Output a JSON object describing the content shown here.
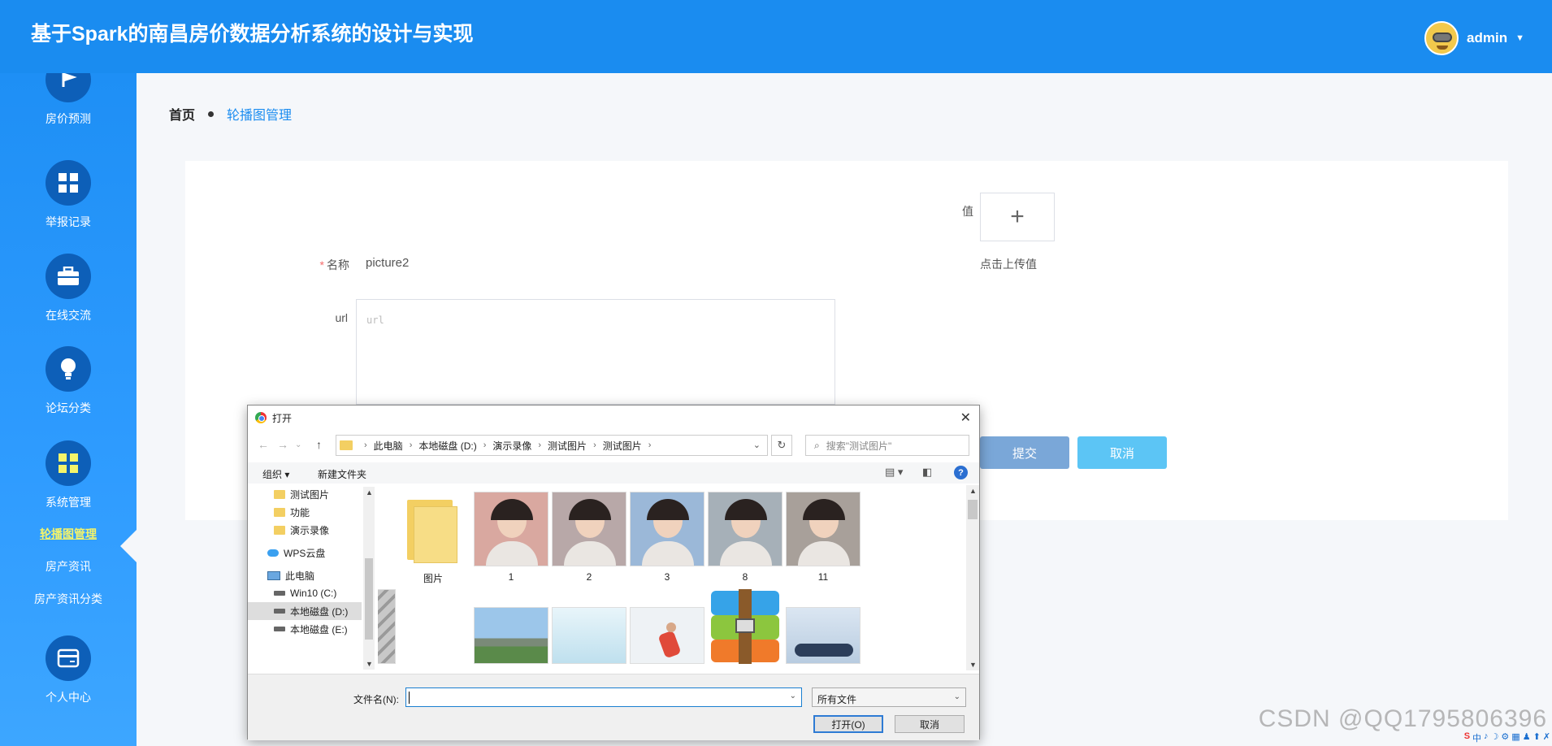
{
  "header": {
    "title": "基于Spark的南昌房价数据分析系统的设计与实现",
    "username": "admin"
  },
  "sidebar": {
    "items": [
      {
        "label": "房价预测",
        "icon": "flag-icon"
      },
      {
        "label": "举报记录",
        "icon": "grid-icon"
      },
      {
        "label": "在线交流",
        "icon": "briefcase-icon"
      },
      {
        "label": "论坛分类",
        "icon": "bulb-icon"
      },
      {
        "label": "系统管理",
        "icon": "grid-icon"
      },
      {
        "label": "个人中心",
        "icon": "card-icon"
      }
    ],
    "sub_items": [
      {
        "label": "轮播图管理",
        "active": true
      },
      {
        "label": "房产资讯",
        "active": false
      },
      {
        "label": "房产资讯分类",
        "active": false
      }
    ]
  },
  "breadcrumb": {
    "home": "首页",
    "current": "轮播图管理"
  },
  "form": {
    "name_label": "名称",
    "name_required": "*",
    "name_value": "picture2",
    "url_label": "url",
    "url_placeholder": "url",
    "value_label": "值",
    "upload_icon": "+",
    "upload_hint": "点击上传值",
    "submit_label": "提交",
    "cancel_label": "取消"
  },
  "dialog": {
    "title": "打开",
    "close": "✕",
    "path": [
      "此电脑",
      "本地磁盘 (D:)",
      "演示录像",
      "测试图片",
      "测试图片"
    ],
    "search_placeholder": "搜索\"测试图片\"",
    "toolbar": {
      "organize": "组织 ▾",
      "new_folder": "新建文件夹"
    },
    "tree": [
      {
        "label": "测试图片",
        "icon": "folder"
      },
      {
        "label": "功能",
        "icon": "folder"
      },
      {
        "label": "演示录像",
        "icon": "folder"
      },
      {
        "label": "WPS云盘",
        "icon": "cloud"
      },
      {
        "label": "此电脑",
        "icon": "pc"
      },
      {
        "label": "Win10 (C:)",
        "icon": "drive"
      },
      {
        "label": "本地磁盘 (D:)",
        "icon": "drive",
        "selected": true
      },
      {
        "label": "本地磁盘 (E:)",
        "icon": "drive"
      }
    ],
    "files": [
      {
        "label": "图片",
        "kind": "folder"
      },
      {
        "label": "1",
        "kind": "portrait",
        "color": "#d9a8a0"
      },
      {
        "label": "2",
        "kind": "portrait",
        "color": "#b8a8a8"
      },
      {
        "label": "3",
        "kind": "portrait",
        "color": "#9bb8d8"
      },
      {
        "label": "8",
        "kind": "portrait",
        "color": "#a6b0b8"
      },
      {
        "label": "11",
        "kind": "portrait",
        "color": "#a8a09a"
      },
      {
        "label": "",
        "kind": "money",
        "color": "#bbbbbb"
      },
      {
        "label": "",
        "kind": "building",
        "color": "#7fb0d8"
      },
      {
        "label": "",
        "kind": "water",
        "color": "#cde7f2"
      },
      {
        "label": "",
        "kind": "runner",
        "color": "#e8eef2"
      },
      {
        "label": "",
        "kind": "archive",
        "color": "#3aa0e0"
      },
      {
        "label": "",
        "kind": "handshake",
        "color": "#c8d8ea"
      }
    ],
    "filename_label": "文件名(N):",
    "filetype_value": "所有文件",
    "open_label": "打开(O)",
    "cancel_label": "取消"
  },
  "watermark": "CSDN @QQ1795806396",
  "tray": [
    "S",
    "中",
    "♪",
    "☽",
    "⚙",
    "▦",
    "♟",
    "⬆",
    "✗"
  ]
}
